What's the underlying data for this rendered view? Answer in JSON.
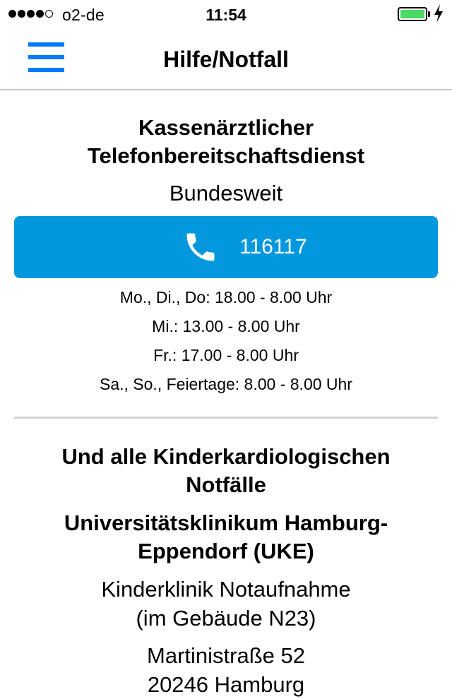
{
  "status_bar": {
    "carrier": "o2-de",
    "time": "11:54"
  },
  "nav": {
    "title": "Hilfe/Notfall",
    "menu_icon": "hamburger-menu-icon"
  },
  "section1": {
    "title_line1": "Kassenärztlicher",
    "title_line2": "Telefonbereitschaftsdienst",
    "subtitle": "Bundesweit",
    "call_icon": "phone-icon",
    "phone": "116117",
    "hours": [
      "Mo., Di., Do:  18.00 - 8.00 Uhr",
      "Mi.:  13.00 - 8.00 Uhr",
      "Fr.:  17.00 - 8.00 Uhr",
      "Sa., So., Feiertage:  8.00 - 8.00 Uhr"
    ]
  },
  "section2": {
    "title_line1": "Und alle Kinderkardiologischen",
    "title_line2": "Notfälle",
    "hospital_line1": "Universitätsklinikum Hamburg-",
    "hospital_line2": "Eppendorf (UKE)",
    "dept_line1": "Kinderklinik Notaufnahme",
    "dept_line2": "(im Gebäude N23)",
    "street": "Martinistraße 52",
    "city": "20246 Hamburg"
  },
  "colors": {
    "accent": "#007aff",
    "call_button": "#0398dd",
    "battery": "#4cd964"
  }
}
